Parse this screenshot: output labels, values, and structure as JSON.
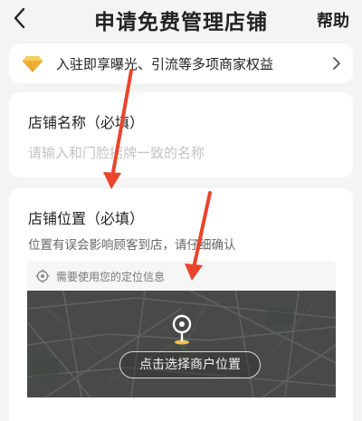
{
  "nav": {
    "title": "申请免费管理店铺",
    "help_label": "帮助",
    "back_icon": "chevron-left-icon"
  },
  "banner": {
    "text": "入驻即享曝光、引流等多项商家权益",
    "icon": "diamond-icon",
    "chevron_icon": "chevron-right-icon",
    "accent_color": "#f2b233"
  },
  "store_name": {
    "label": "店铺名称（必填）",
    "placeholder": "请输入和门脸招牌一致的名称"
  },
  "store_location": {
    "label": "店铺位置（必填）",
    "hint": "位置有误会影响顾客到店，请仔细确认",
    "locate_notice": "需要使用您的定位信息",
    "choose_button": "点击选择商户位置",
    "marker_color": "#f2c14a"
  },
  "annotation_color": "#e8452c"
}
